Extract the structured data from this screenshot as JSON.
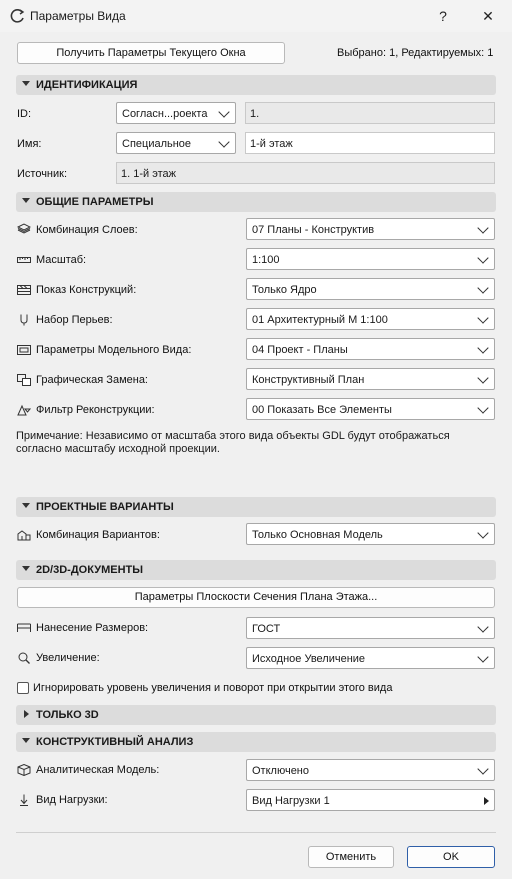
{
  "window": {
    "title": "Параметры Вида",
    "help": "?",
    "close": "✕"
  },
  "top": {
    "get_params": "Получить Параметры Текущего Окна",
    "status": "Выбрано: 1, Редактируемых: 1"
  },
  "ident": {
    "header": "ИДЕНТИФИКАЦИЯ",
    "id_label": "ID:",
    "id_select": "Согласн...роекта",
    "id_value": "1.",
    "name_label": "Имя:",
    "name_select": "Специальное",
    "name_value": "1-й этаж",
    "source_label": "Источник:",
    "source_value": "1. 1-й этаж"
  },
  "general": {
    "header": "ОБЩИЕ ПАРАМЕТРЫ",
    "rows": [
      {
        "label": "Комбинация Слоев:",
        "value": "07 Планы - Конструктив",
        "icon": "layers-icon"
      },
      {
        "label": "Масштаб:",
        "value": "1:100",
        "icon": "ruler-icon"
      },
      {
        "label": "Показ Конструкций:",
        "value": "Только Ядро",
        "icon": "structure-display-icon"
      },
      {
        "label": "Набор Перьев:",
        "value": "01 Архитектурный М 1:100",
        "icon": "pen-icon"
      },
      {
        "label": "Параметры Модельного Вида:",
        "value": "04 Проект - Планы",
        "icon": "model-view-icon"
      },
      {
        "label": "Графическая Замена:",
        "value": "Конструктивный План",
        "icon": "graphic-override-icon"
      },
      {
        "label": "Фильтр Реконструкции:",
        "value": "00 Показать Все Элементы",
        "icon": "renovation-filter-icon"
      }
    ],
    "note": "Примечание: Независимо от масштаба этого вида объекты GDL будут отображаться согласно масштабу исходной проекции."
  },
  "design": {
    "header": "ПРОЕКТНЫЕ ВАРИАНТЫ",
    "label": "Комбинация Вариантов:",
    "value": "Только Основная Модель"
  },
  "docs": {
    "header": "2D/3D-ДОКУМЕНТЫ",
    "cut_plane_btn": "Параметры Плоскости Сечения Плана Этажа...",
    "dim_label": "Нанесение Размеров:",
    "dim_value": "ГОСТ",
    "zoom_label": "Увеличение:",
    "zoom_value": "Исходное Увеличение",
    "ignore_label": "Игнорировать уровень увеличения и поворот при открытии этого вида"
  },
  "only3d": {
    "header": "ТОЛЬКО 3D"
  },
  "struct": {
    "header": "КОНСТРУКТИВНЫЙ АНАЛИЗ",
    "model_label": "Аналитическая Модель:",
    "model_value": "Отключено",
    "load_label": "Вид Нагрузки:",
    "load_value": "Вид Нагрузки 1"
  },
  "footer": {
    "cancel": "Отменить",
    "ok": "OK"
  }
}
